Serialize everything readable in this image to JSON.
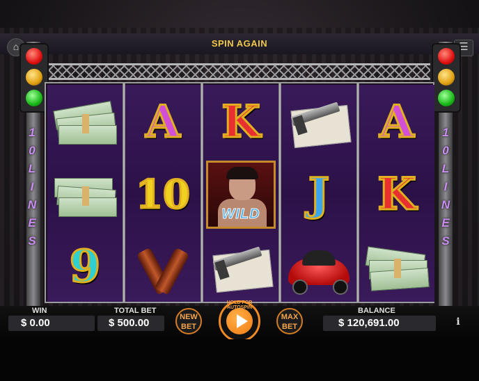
{
  "header": {
    "spin_again": "SPIN AGAIN"
  },
  "side_labels": {
    "left": [
      "1",
      "0",
      "L",
      "I",
      "N",
      "E",
      "S"
    ],
    "right": [
      "1",
      "0",
      "L",
      "I",
      "N",
      "E",
      "S"
    ]
  },
  "reels": [
    [
      "cash-stack",
      "cash-stack",
      "9"
    ],
    [
      "A",
      "10",
      "beer-bottles"
    ],
    [
      "K",
      "wild",
      "pistol-newspaper"
    ],
    [
      "pistol-newspaper",
      "J",
      "red-sports-car"
    ],
    [
      "A",
      "K",
      "cash-stack"
    ]
  ],
  "wild_label": "WILD",
  "hud": {
    "win_label": "WIN",
    "win_value": "$ 0.00",
    "total_bet_label": "TOTAL BET",
    "total_bet_value": "$ 500.00",
    "new_bet_label_1": "NEW",
    "new_bet_label_2": "BET",
    "hold_for_autospin": "HOLD FOR AUTOSPIN",
    "max_bet_label_1": "MAX",
    "max_bet_label_2": "BET",
    "balance_label": "BALANCE",
    "balance_value": "$ 120,691.00"
  },
  "icons": {
    "home": "home-icon",
    "menu": "menu-icon",
    "info": "info-icon",
    "spin": "play-icon"
  },
  "colors": {
    "accent": "#f08a22",
    "reel_bg": "#2c1148",
    "lines_text": "#c98cf0"
  }
}
